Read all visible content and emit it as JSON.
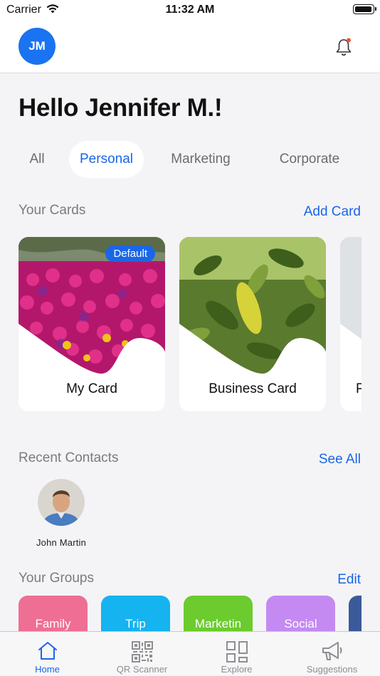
{
  "status_bar": {
    "carrier": "Carrier",
    "time": "11:32 AM"
  },
  "header": {
    "avatar_initials": "JM",
    "accent": "#1a73f0"
  },
  "greeting": "Hello Jennifer M.!",
  "tabs": [
    {
      "label": "All",
      "active": false
    },
    {
      "label": "Personal",
      "active": true
    },
    {
      "label": "Marketing",
      "active": false
    },
    {
      "label": "Corporate",
      "active": false
    }
  ],
  "cards_section": {
    "title": "Your Cards",
    "action": "Add Card",
    "cards": [
      {
        "label": "My Card",
        "badge": "Default"
      },
      {
        "label": "Business Card"
      },
      {
        "label": "P"
      }
    ]
  },
  "contacts_section": {
    "title": "Recent Contacts",
    "action": "See All",
    "contacts": [
      {
        "name": "John Martin"
      }
    ]
  },
  "groups_section": {
    "title": "Your Groups",
    "action": "Edit",
    "groups": [
      {
        "label": "Family",
        "color": "#ee6f93"
      },
      {
        "label": "Trip",
        "color": "#15b3ef"
      },
      {
        "label": "Marketin",
        "color": "#6ccb2e"
      },
      {
        "label": "Social",
        "color": "#c48af2"
      },
      {
        "label": "",
        "color": "#3b5a9a"
      }
    ]
  },
  "tab_bar": {
    "items": [
      {
        "label": "Home",
        "icon": "home-icon",
        "active": true
      },
      {
        "label": "QR Scanner",
        "icon": "qr-icon",
        "active": false
      },
      {
        "label": "Explore",
        "icon": "grid-icon",
        "active": false
      },
      {
        "label": "Suggestions",
        "icon": "megaphone-icon",
        "active": false
      }
    ]
  }
}
